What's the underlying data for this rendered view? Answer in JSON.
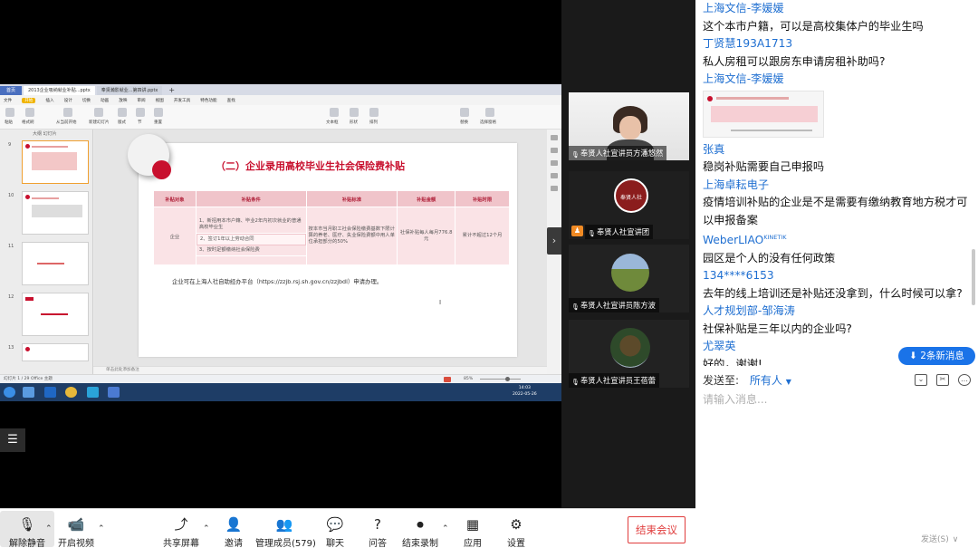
{
  "ppt": {
    "tabs": [
      "首页",
      "2013企业吸纳就业补贴...pptx",
      "奉贤瀚影就业...第四讲.pptx"
    ],
    "menu": [
      "文件",
      "开始",
      "插入",
      "设计",
      "切换",
      "动画",
      "放映",
      "审阅",
      "视图",
      "开发工具",
      "特色功能",
      "查找"
    ],
    "ribbon": [
      "粘贴",
      "格式刷",
      "从当前开始",
      "新建幻灯片",
      "版式",
      "节",
      "重置",
      "文本框",
      "形状",
      "排列",
      "替换",
      "选择窗格"
    ],
    "left_header": "大纲  幻灯片",
    "thumb_nums": [
      "9",
      "10",
      "11",
      "12",
      "13"
    ],
    "slide_title": "（二）企业录用高校毕业生社会保险费补贴",
    "table": {
      "headers": [
        "补贴对象",
        "补贴条件",
        "补贴标准",
        "补贴金额",
        "补贴时限"
      ],
      "object": "企业",
      "conditions": [
        "1、新招用本市户籍、毕业2年内初次就业的普通高校毕业生",
        "2、签订1年以上劳动合同",
        "3、按时足额缴纳社会保险费"
      ],
      "standard": "按本市当月职工社会保险缴费基数下限计算的养老、医疗、失业保险费额中用人单位承担部分的50%",
      "amount": "社保补贴每人每月776.8元",
      "period": "累计不超过12个月"
    },
    "note": "企业可在上海人社自助经办平台（https://zzjb.rsj.sh.gov.cn/zzjbdl）申请办理。",
    "notes_placeholder": "单击此处添加备注",
    "status_left": "幻灯片 1 / 29    Office 主题",
    "zoom": "85%",
    "clock_time": "14:03",
    "clock_date": "2022-05-26"
  },
  "videos": [
    {
      "name": "奉贤人社宣讲员方潘悠然"
    },
    {
      "name": "奉贤人社宣讲团",
      "avatar_text": "奉贤人社"
    },
    {
      "name": "奉贤人社宣讲员陈方波"
    },
    {
      "name": "奉贤人社宣讲员王蓓蕾"
    }
  ],
  "chat": {
    "messages": [
      {
        "sender": "上海文信-李媛媛",
        "text": "这个本市户籍，可以是高校集体户的毕业生吗"
      },
      {
        "sender": "丁贤慧193A1713",
        "text": "私人房租可以跟房东申请房租补助吗?"
      },
      {
        "sender": "上海文信-李媛媛",
        "image": true
      },
      {
        "sender": "张真",
        "text": "稳岗补贴需要自己申报吗"
      },
      {
        "sender": "上海卓耘电子",
        "text": "疫情培训补贴的企业是不是需要有缴纳教育地方税才可以申报备案"
      },
      {
        "sender": "WeberLIAO",
        "sender_sup": "KINETIK",
        "text": "园区是个人的没有任何政策"
      },
      {
        "sender": "134****6153",
        "text": "去年的线上培训还是补贴还没拿到，什么时候可以拿?"
      },
      {
        "sender": "人才规划部-邹海涛",
        "text": "社保补贴是三年以内的企业吗?"
      },
      {
        "sender": "尤翠英",
        "text": "好的，谢谢!"
      }
    ],
    "new_messages": "2条新消息",
    "send_to_label": "发送至:",
    "send_to_value": "所有人",
    "input_placeholder": "请输入消息...",
    "send_button": "发送(S)"
  },
  "toolbar": {
    "mute": "解除静音",
    "video": "开启视频",
    "share": "共享屏幕",
    "invite": "邀请",
    "participants": "管理成员(579)",
    "chat": "聊天",
    "qa": "问答",
    "record": "结束录制",
    "apps": "应用",
    "settings": "设置",
    "end": "结束会议"
  },
  "colors": {
    "accent": "#1a73e8",
    "slide_red": "#c8102e",
    "end_red": "#e03c3c"
  }
}
